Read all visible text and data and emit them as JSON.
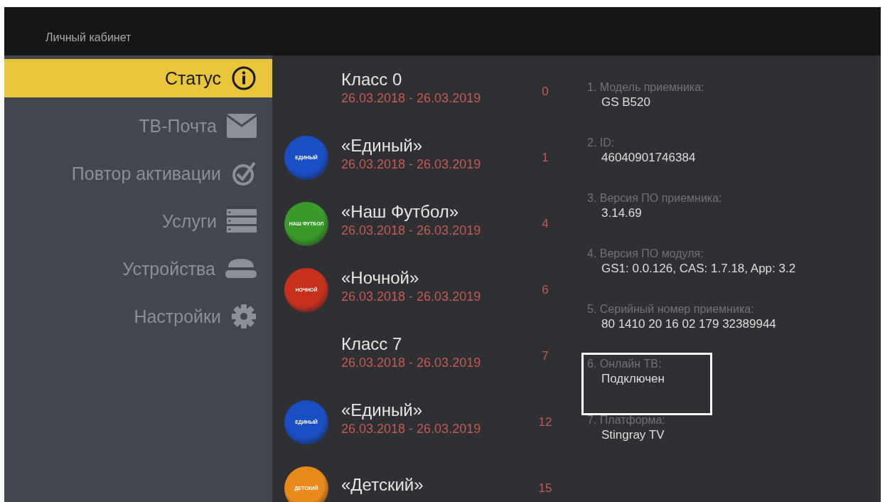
{
  "header": {
    "title": "Личный кабинет"
  },
  "sidebar": {
    "items": [
      {
        "label": "Статус",
        "selected": true
      },
      {
        "label": "ТВ-Почта",
        "selected": false
      },
      {
        "label": "Повтор активации",
        "selected": false
      },
      {
        "label": "Услуги",
        "selected": false
      },
      {
        "label": "Устройства",
        "selected": false
      },
      {
        "label": "Настройки",
        "selected": false
      }
    ]
  },
  "packages": [
    {
      "title": "Класс 0",
      "period": "26.03.2018 - 26.03.2019",
      "number": "0"
    },
    {
      "title": "«Единый»",
      "period": "26.03.2018 - 26.03.2019",
      "number": "1",
      "logo_text": "ЕДИНЫЙ",
      "color": "#1a4fc4"
    },
    {
      "title": "«Наш Футбол»",
      "period": "26.03.2018 - 26.03.2019",
      "number": "4",
      "logo_text": "НАШ ФУТБОЛ",
      "color": "#3a9a2a"
    },
    {
      "title": "«Ночной»",
      "period": "26.03.2018 - 26.03.2019",
      "number": "6",
      "logo_text": "НОЧНОЙ",
      "color": "#c8301e"
    },
    {
      "title": "Класс 7",
      "period": "26.03.2018 - 26.03.2019",
      "number": "7"
    },
    {
      "title": "«Единый»",
      "period": "26.03.2018 - 26.03.2019",
      "number": "12",
      "logo_text": "ЕДИНЫЙ",
      "color": "#1a4fc4"
    },
    {
      "title": "«Детский»",
      "number": "15",
      "logo_text": "ДЕТСКИЙ",
      "color": "#e8891c"
    }
  ],
  "info": [
    {
      "label": "1. Модель приемника:",
      "value": "GS B520",
      "highlighted": false
    },
    {
      "label": "2. ID:",
      "value": "46040901746384",
      "highlighted": false
    },
    {
      "label": "3. Версия ПО приемника:",
      "value": "3.14.69",
      "highlighted": false
    },
    {
      "label": "4. Версия ПО модуля:",
      "value": "GS1: 0.0.126, CAS: 1.7.18, App: 3.2",
      "highlighted": false
    },
    {
      "label": "5. Серийный номер приемника:",
      "value": "80 1410 20 16 02 179 32389944",
      "highlighted": false
    },
    {
      "label": "6. Онлайн ТВ:",
      "value": "Подключен",
      "highlighted": true
    },
    {
      "label": "7. Платформа:",
      "value": "Stingray TV",
      "highlighted": false
    }
  ]
}
